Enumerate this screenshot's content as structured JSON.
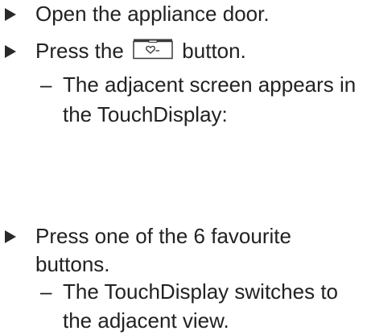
{
  "steps": [
    {
      "text": "Open the appliance door."
    },
    {
      "text_before": "Press the",
      "icon": "favourite-heart-button-icon",
      "text_after": "button.",
      "result_dash": "–",
      "result_line1": "The adjacent screen appears in",
      "result_line2": "the TouchDisplay:"
    },
    {
      "line1": "Press one of the 6 favourite",
      "line2": "buttons.",
      "result_dash": "–",
      "result_line1": "The TouchDisplay switches to",
      "result_line2": "the adjacent view."
    }
  ],
  "colors": {
    "text": "#222222",
    "arrow": "#2a2a2a"
  }
}
